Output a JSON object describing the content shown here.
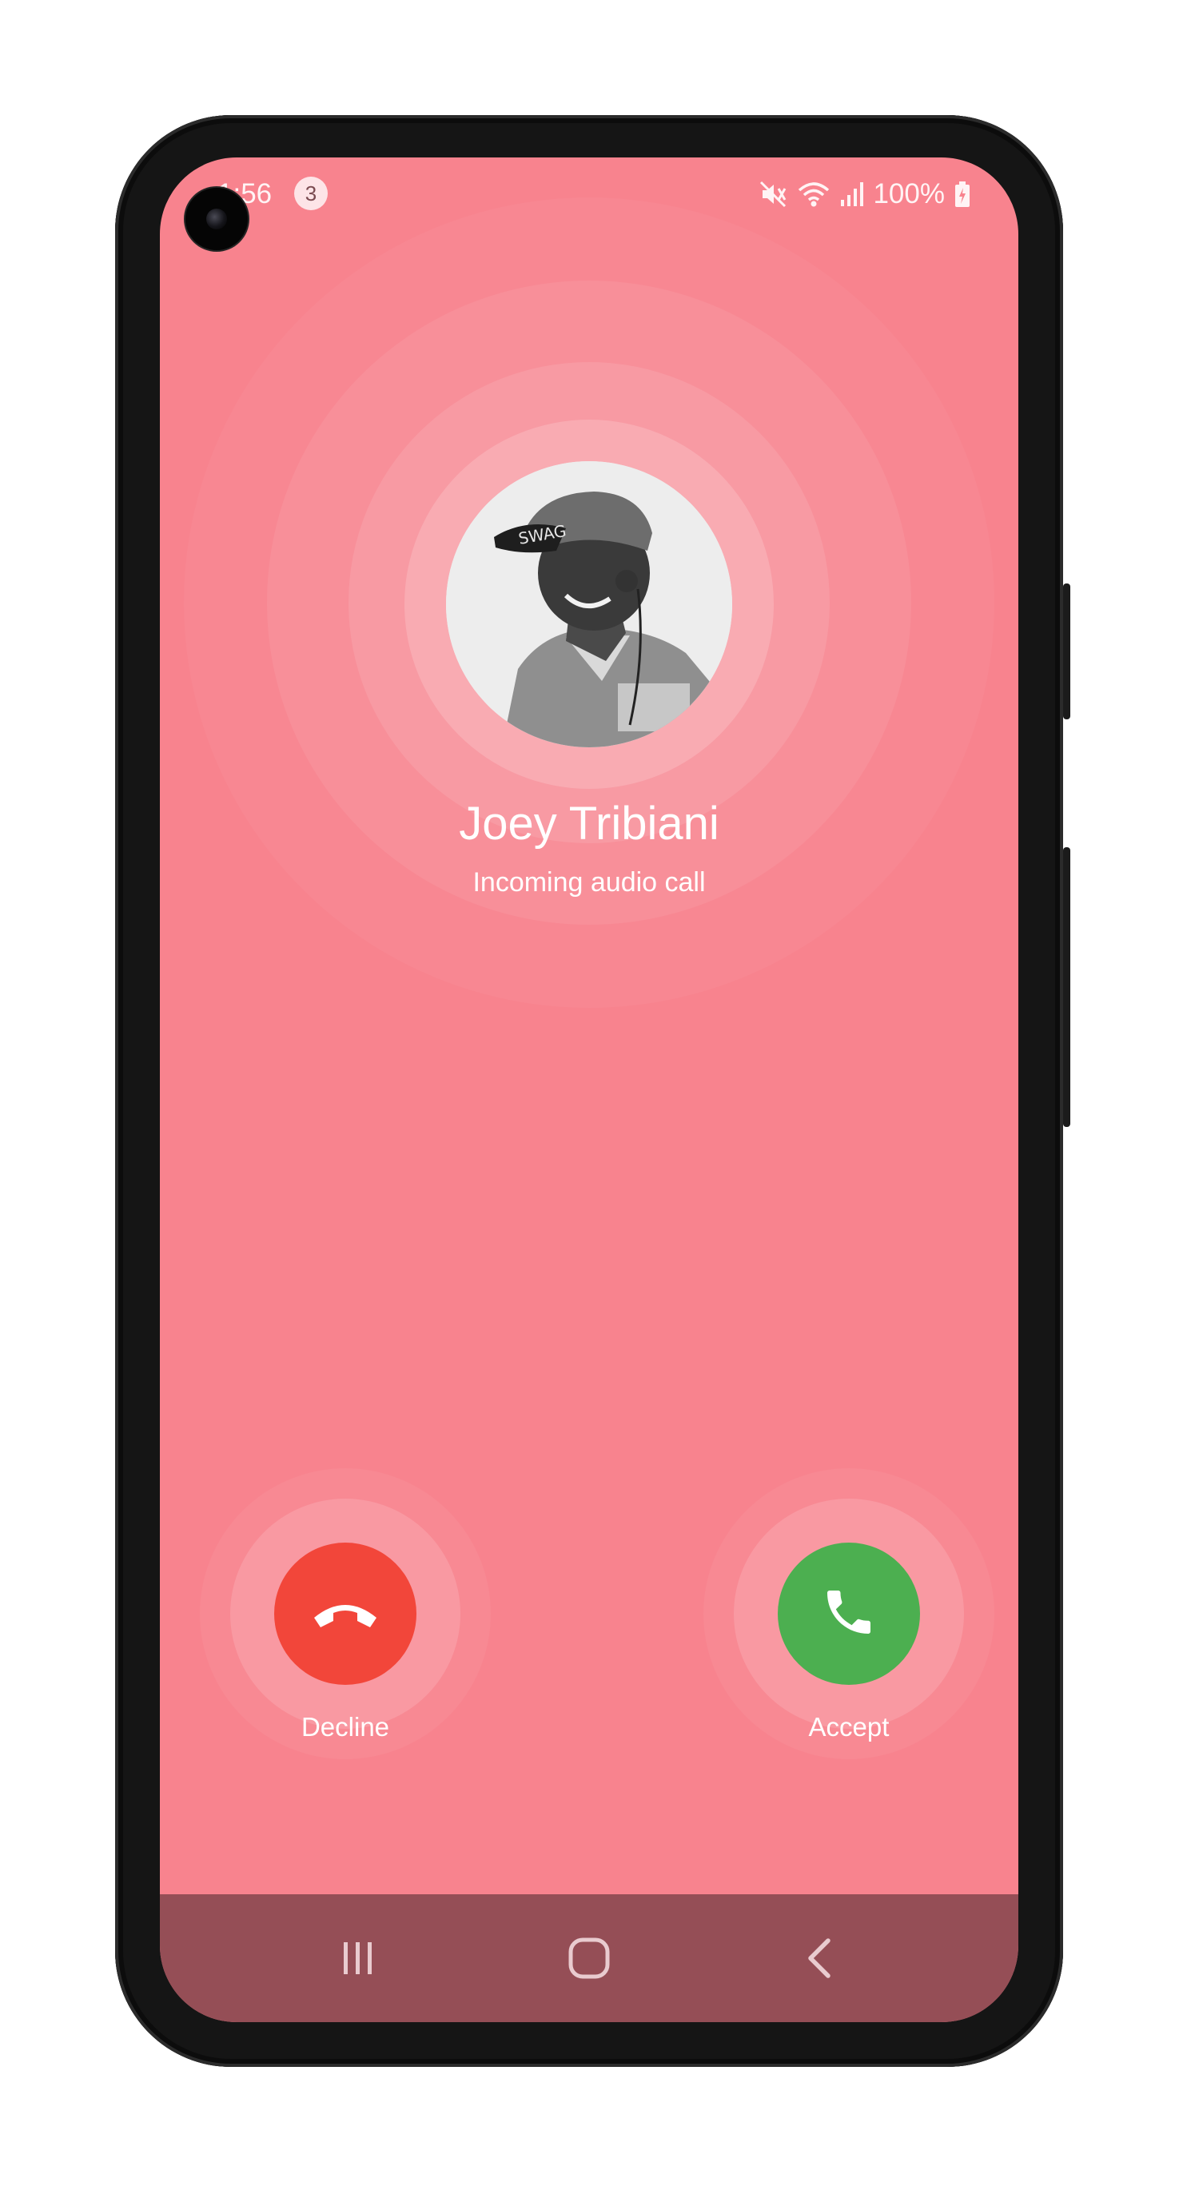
{
  "status_bar": {
    "time": "1:56",
    "notification_count": "3",
    "battery": "100%",
    "icons": [
      "mute-icon",
      "wifi-icon",
      "signal-icon",
      "battery-charging-icon"
    ]
  },
  "call": {
    "caller_name": "Joey Tribiani",
    "call_type": "Incoming audio call",
    "avatar": "caller-photo"
  },
  "actions": {
    "decline": {
      "label": "Decline",
      "icon": "phone-hangup-icon",
      "color": "#f2463a"
    },
    "accept": {
      "label": "Accept",
      "icon": "phone-icon",
      "color": "#4caf50"
    }
  },
  "nav_bar": {
    "items": [
      "recent-apps-icon",
      "home-icon",
      "back-icon"
    ]
  },
  "colors": {
    "background": "#f8838e",
    "nav_bar": "#954e56",
    "phone_frame": "#151515"
  }
}
